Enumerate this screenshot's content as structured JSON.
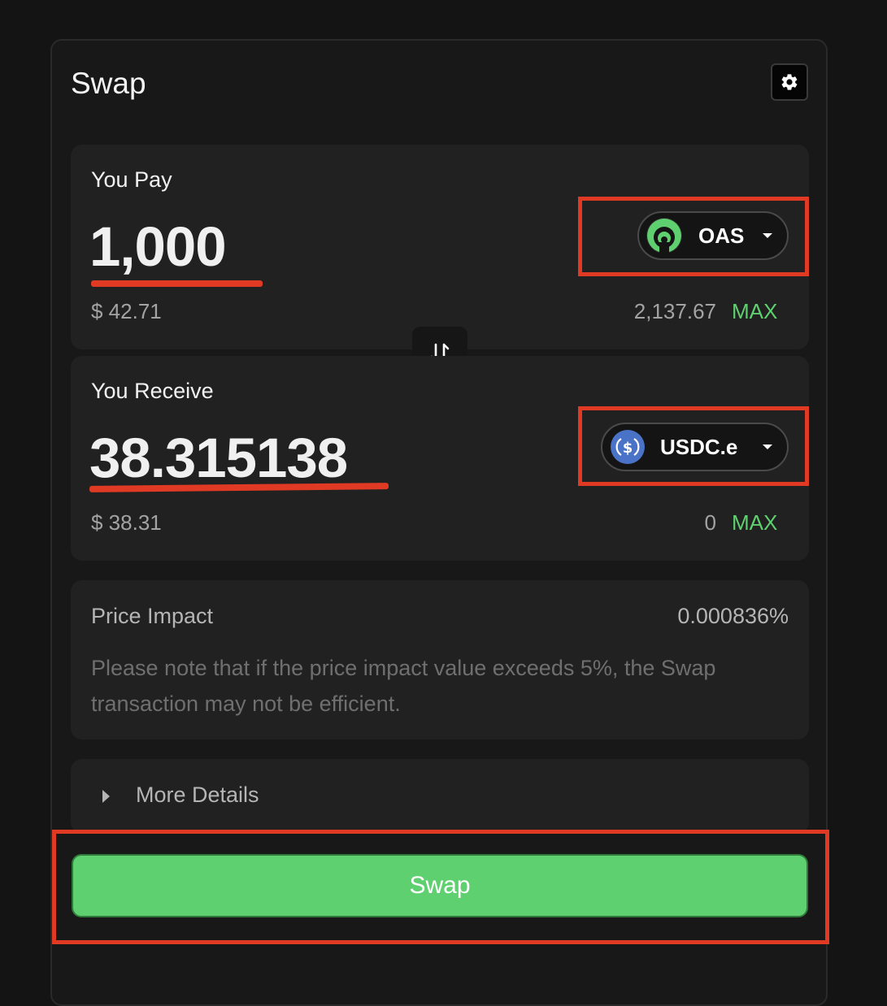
{
  "header": {
    "title": "Swap",
    "settings_icon": "gear-icon"
  },
  "pay": {
    "label": "You Pay",
    "amount": "1,000",
    "usd_value": "$ 42.71",
    "balance": "2,137.67",
    "max_label": "MAX",
    "token": {
      "symbol": "OAS",
      "icon": "oas-token-icon",
      "icon_color": "#5fd06f"
    }
  },
  "switch": {
    "icon": "swap-arrows-icon"
  },
  "receive": {
    "label": "You Receive",
    "amount": "38.315138",
    "usd_value": "$ 38.31",
    "balance": "0",
    "max_label": "MAX",
    "token": {
      "symbol": "USDC.e",
      "icon": "usdc-token-icon",
      "icon_color": "#4a73c7"
    }
  },
  "price_impact": {
    "label": "Price Impact",
    "value": "0.000836%",
    "note": "Please note that if the price impact value exceeds 5%, the Swap transaction may not be efficient."
  },
  "details": {
    "label": "More Details",
    "icon": "caret-right-icon"
  },
  "action": {
    "swap_label": "Swap"
  },
  "colors": {
    "accent": "#5fd06f",
    "highlight": "#e03a24",
    "background": "#141414",
    "panel": "#212121"
  }
}
